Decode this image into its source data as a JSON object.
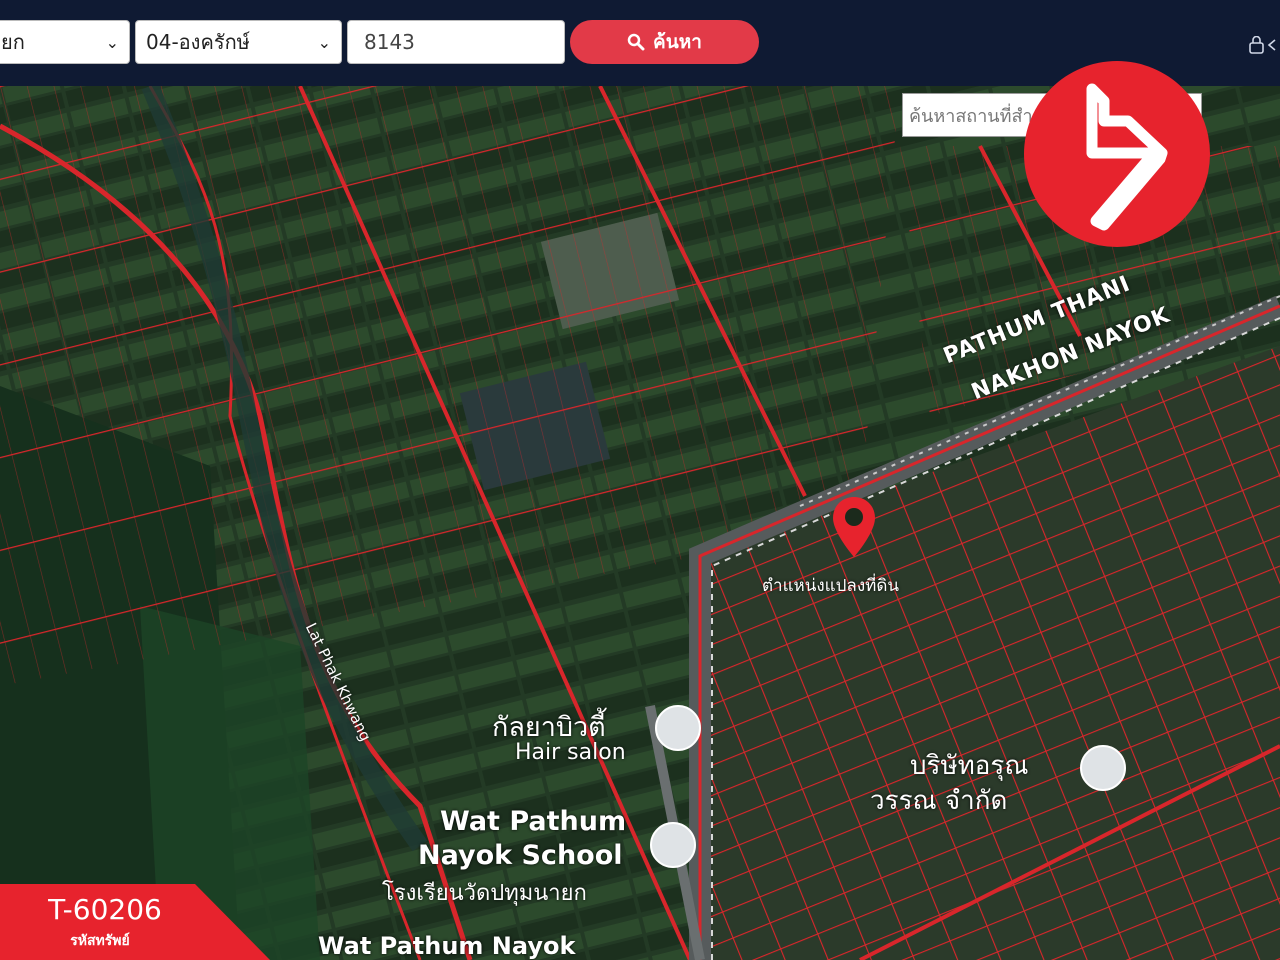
{
  "toolbar": {
    "province_select": "ยก",
    "district_select": "04-องครักษ์",
    "parcel_input": "8143",
    "search_button": "ค้นหา"
  },
  "map": {
    "place_search_placeholder": "ค้นหาสถานที่สำคัญ",
    "pin_label": "ตำแหน่งแปลงที่ดิน",
    "road_label_1": "PATHUM THANI",
    "road_label_2": "NAKHON NAYOK",
    "canal_label": "Lat Phak Khwang",
    "poi_salon_name": "กัลยาบิวตี้",
    "poi_salon_type": "Hair salon",
    "poi_school_1": "Wat Pathum",
    "poi_school_2": "Nayok School",
    "poi_school_thai": "โรงเรียนวัดปทุมนายก",
    "poi_temple": "Wat Pathum Nayok",
    "poi_company_1": "บริษัทอรุณ",
    "poi_company_2": "วรรณ จำกัด"
  },
  "listing": {
    "code": "T-60206",
    "code_label": "รหัสทรัพย์"
  },
  "colors": {
    "topbar": "#0f1a33",
    "accent": "#e23a48",
    "parcel_line": "#d8262b",
    "logo": "#e7232d"
  },
  "icons": [
    "search-icon",
    "chevron-down-icon",
    "lock-icon",
    "location-pin-icon",
    "brand-logo-icon",
    "poi-icon"
  ]
}
